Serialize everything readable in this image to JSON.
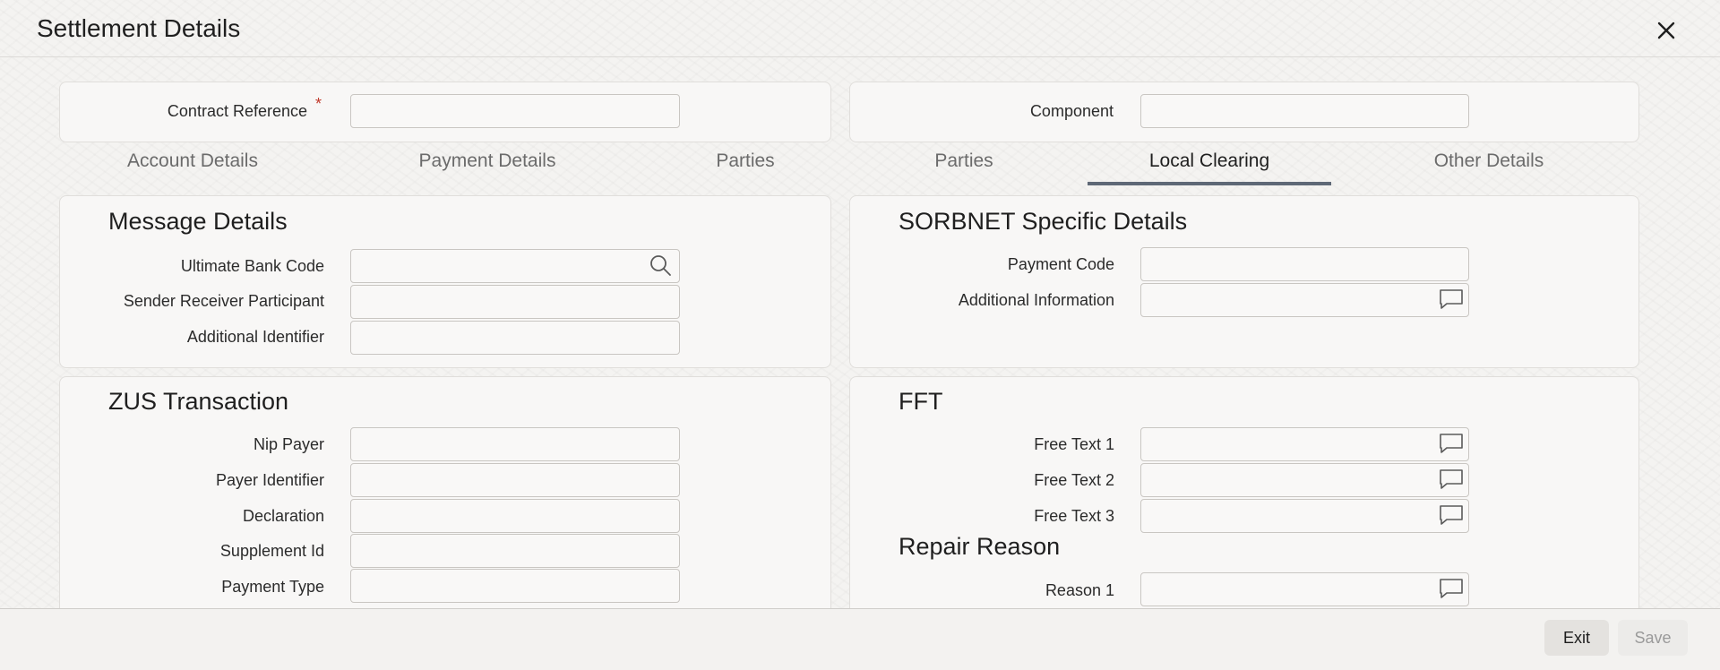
{
  "window": {
    "title": "Settlement Details"
  },
  "header": {
    "contract_reference_label": "Contract Reference",
    "contract_reference_required": "*",
    "contract_reference_value": "",
    "component_label": "Component",
    "component_value": ""
  },
  "tabs": [
    {
      "label": "Account Details"
    },
    {
      "label": "Payment Details"
    },
    {
      "label": "Parties"
    },
    {
      "label": "Parties"
    },
    {
      "label": "Local Clearing"
    },
    {
      "label": "Other Details"
    }
  ],
  "active_tab": "Local Clearing",
  "message_details": {
    "title": "Message Details",
    "ultimate_bank_code_label": "Ultimate Bank Code",
    "ultimate_bank_code_value": "",
    "sender_receiver_participant_label": "Sender Receiver Participant",
    "sender_receiver_participant_value": "",
    "additional_identifier_label": "Additional Identifier",
    "additional_identifier_value": ""
  },
  "sorbnet": {
    "title": "SORBNET Specific Details",
    "payment_code_label": "Payment Code",
    "payment_code_value": "",
    "additional_information_label": "Additional Information",
    "additional_information_value": ""
  },
  "zus": {
    "title": "ZUS Transaction",
    "nip_payer_label": "Nip Payer",
    "nip_payer_value": "",
    "payer_identifier_label": "Payer Identifier",
    "payer_identifier_value": "",
    "declaration_label": "Declaration",
    "declaration_value": "",
    "supplement_id_label": "Supplement Id",
    "supplement_id_value": "",
    "payment_type_label": "Payment Type",
    "payment_type_value": ""
  },
  "fft": {
    "title": "FFT",
    "free_text_1_label": "Free Text 1",
    "free_text_1_value": "",
    "free_text_2_label": "Free Text 2",
    "free_text_2_value": "",
    "free_text_3_label": "Free Text 3",
    "free_text_3_value": ""
  },
  "repair": {
    "title": "Repair Reason",
    "reason_1_label": "Reason 1",
    "reason_1_value": ""
  },
  "footer": {
    "exit_label": "Exit",
    "save_label": "Save"
  },
  "colors": {
    "accent_underline": "#5e6876",
    "required": "#c0392b"
  },
  "icons": {
    "close": "close-icon",
    "search": "search-icon",
    "comment": "comment-icon"
  }
}
